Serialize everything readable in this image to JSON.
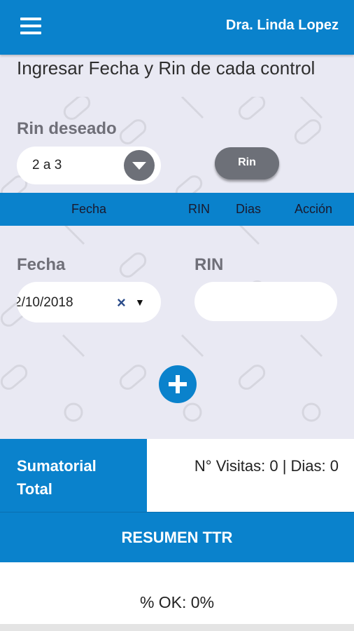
{
  "header": {
    "doctor_name": "Dra. Linda Lopez"
  },
  "main": {
    "instruction": "Ingresar Fecha y Rin de cada control",
    "rin_deseado_label": "Rin deseado",
    "rin_deseado_value": "2 a 3",
    "rin_button": "Rin",
    "table_headers": [
      "Fecha",
      "RIN",
      "Dias",
      "Acción"
    ],
    "fecha_label": "Fecha",
    "fecha_value": "2/10/2018",
    "rin_label": "RIN",
    "rin_value": ""
  },
  "summary": {
    "label_line1": "Sumatorial",
    "label_line2": "Total",
    "value": "N° Visitas: 0 | Dias: 0",
    "resumen_title": "RESUMEN TTR",
    "ok_text": "% OK: 0%"
  },
  "colors": {
    "primary": "#0a82cc",
    "gray_button": "#6d7078",
    "background": "#e9e9f3"
  },
  "icons": [
    "menu-icon",
    "chevron-down-icon",
    "clear-icon",
    "dropdown-arrow-icon",
    "plus-icon"
  ]
}
